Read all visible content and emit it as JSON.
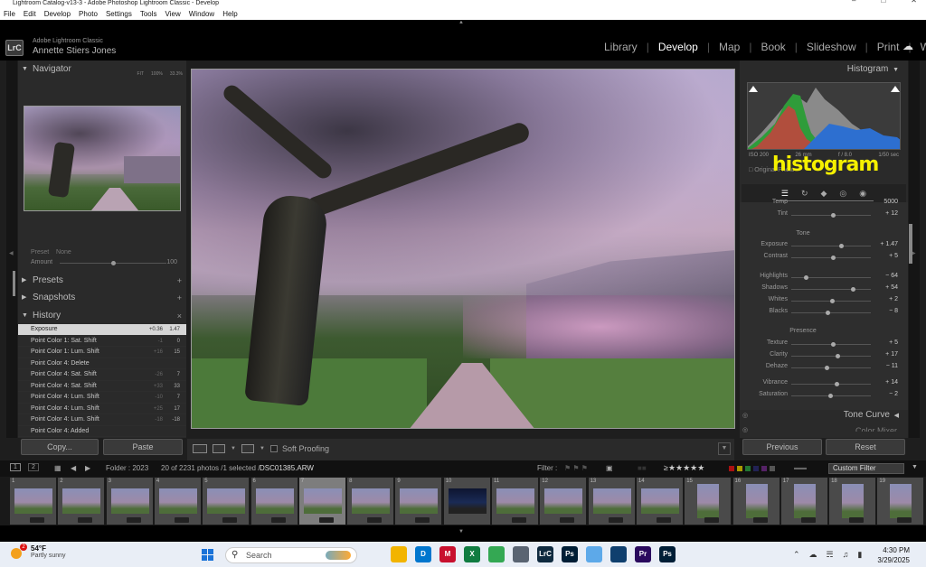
{
  "window": {
    "title": "Lightroom Catalog-v13-3 - Adobe Photoshop Lightroom Classic - Develop"
  },
  "menu": [
    "File",
    "Edit",
    "Develop",
    "Photo",
    "Settings",
    "Tools",
    "View",
    "Window",
    "Help"
  ],
  "identity": {
    "badge": "LrC",
    "app": "Adobe Lightroom Classic",
    "user": "Annette Stiers Jones"
  },
  "modules": [
    {
      "label": "Library"
    },
    {
      "label": "Develop",
      "active": true
    },
    {
      "label": "Map"
    },
    {
      "label": "Book"
    },
    {
      "label": "Slideshow"
    },
    {
      "label": "Print"
    },
    {
      "label": "Web"
    }
  ],
  "navigator": {
    "title": "Navigator",
    "zoom": [
      "FIT",
      "100%",
      "33.3%"
    ]
  },
  "preset": {
    "label": "Preset",
    "value": "None",
    "amount_label": "Amount",
    "amount_value": "100",
    "amount_level": 0.5
  },
  "panels": {
    "presets": "Presets",
    "snapshots": "Snapshots",
    "history": "History"
  },
  "history": [
    {
      "name": "Exposure",
      "a": "+0.36",
      "b": "1.47",
      "selected": true
    },
    {
      "name": "Point Color 1: Sat. Shift",
      "a": "-1",
      "b": "0"
    },
    {
      "name": "Point Color 1: Lum. Shift",
      "a": "+16",
      "b": "15"
    },
    {
      "name": "Point Color 4: Delete",
      "a": "",
      "b": ""
    },
    {
      "name": "Point Color 4: Sat. Shift",
      "a": "-26",
      "b": "7"
    },
    {
      "name": "Point Color 4: Sat. Shift",
      "a": "+33",
      "b": "33"
    },
    {
      "name": "Point Color 4: Lum. Shift",
      "a": "-10",
      "b": "7"
    },
    {
      "name": "Point Color 4: Lum. Shift",
      "a": "+25",
      "b": "17"
    },
    {
      "name": "Point Color 4: Lum. Shift",
      "a": "-18",
      "b": "-18"
    },
    {
      "name": "Point Color 4: Added",
      "a": "",
      "b": ""
    }
  ],
  "left_buttons": {
    "copy": "Copy...",
    "paste": "Paste"
  },
  "toolbar": {
    "soft_proofing": "Soft Proofing"
  },
  "histogram": {
    "title": "Histogram",
    "iso": "ISO 200",
    "focal": "26 mm",
    "aperture": "f / 8.0",
    "shutter": "1/50 sec",
    "original": "Original Photo",
    "overlay": "histogram"
  },
  "basic": {
    "partial_top": {
      "label": "Temp",
      "value": "5000"
    },
    "tint": {
      "label": "Tint",
      "value": "+ 12",
      "level": 0.52
    },
    "tone_title": "Tone",
    "presence_title": "Presence",
    "tone": [
      {
        "label": "Exposure",
        "value": "+ 1.47",
        "level": 0.62
      },
      {
        "label": "Contrast",
        "value": "+ 5",
        "level": 0.52
      },
      {
        "label": "Highlights",
        "value": "− 64",
        "level": 0.18
      },
      {
        "label": "Shadows",
        "value": "+ 54",
        "level": 0.77
      },
      {
        "label": "Whites",
        "value": "+ 2",
        "level": 0.51
      },
      {
        "label": "Blacks",
        "value": "− 8",
        "level": 0.46
      }
    ],
    "presence": [
      {
        "label": "Texture",
        "value": "+ 5",
        "level": 0.52
      },
      {
        "label": "Clarity",
        "value": "+ 17",
        "level": 0.58
      },
      {
        "label": "Dehaze",
        "value": "− 11",
        "level": 0.44
      },
      {
        "label": "Vibrance",
        "value": "+ 14",
        "level": 0.57
      },
      {
        "label": "Saturation",
        "value": "− 2",
        "level": 0.49
      }
    ]
  },
  "right_panels": {
    "tone_curve": "Tone Curve",
    "color_mixer": "Color Mixer"
  },
  "right_buttons": {
    "previous": "Previous",
    "reset": "Reset"
  },
  "filmbar": {
    "page1": "1",
    "page2": "2",
    "folder": "Folder : 2023",
    "count": "20 of 2231 photos /1 selected /",
    "file": "DSC01385.ARW",
    "filter_label": "Filter :",
    "custom_filter": "Custom Filter"
  },
  "filmstrip": {
    "numbers": [
      "1",
      "2",
      "3",
      "4",
      "5",
      "6",
      "7",
      "8",
      "9",
      "10",
      "11",
      "12",
      "13",
      "14",
      "15",
      "16",
      "17",
      "18",
      "19"
    ],
    "selected": "7"
  },
  "taskbar": {
    "temp": "54°F",
    "condition": "Partly sunny",
    "weather_badge": "2",
    "search": "Search",
    "time": "4:30 PM",
    "date": "3/29/2025"
  },
  "taskbar_apps": [
    {
      "name": "file-explorer-icon",
      "color": "#f2b400",
      "label": ""
    },
    {
      "name": "dell-icon",
      "color": "#0076ce",
      "label": "D"
    },
    {
      "name": "mcafee-icon",
      "color": "#c8102e",
      "label": "M"
    },
    {
      "name": "excel-icon",
      "color": "#107c41",
      "label": "X"
    },
    {
      "name": "chrome-icon",
      "color": "#34a853",
      "label": ""
    },
    {
      "name": "calculator-icon",
      "color": "#5a6472",
      "label": ""
    },
    {
      "name": "lightroom-classic-icon",
      "color": "#0f2a3f",
      "label": "LrC"
    },
    {
      "name": "photoshop-icon",
      "color": "#001e36",
      "label": "Ps"
    },
    {
      "name": "photos-icon",
      "color": "#5da9e9",
      "label": ""
    },
    {
      "name": "capture-icon",
      "color": "#0f3f6e",
      "label": ""
    },
    {
      "name": "premiere-icon",
      "color": "#2a0a5e",
      "label": "Pr"
    },
    {
      "name": "photoshop-2-icon",
      "color": "#001e36",
      "label": "Ps"
    }
  ]
}
